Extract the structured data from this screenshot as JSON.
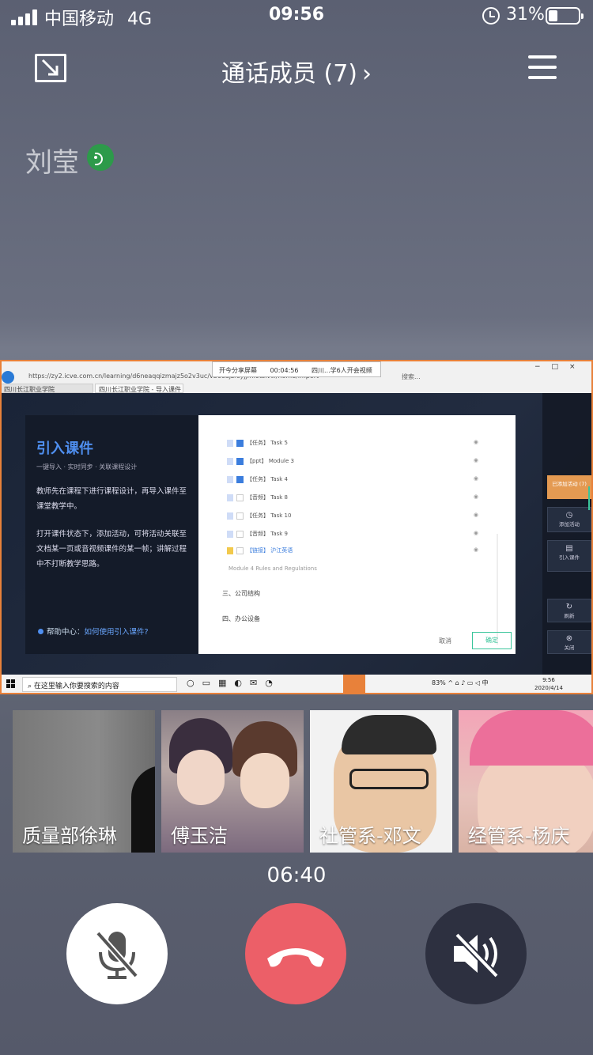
{
  "status": {
    "carrier": "中国移动",
    "network": "4G",
    "time": "09:56",
    "battery": "31%",
    "battery_level": 0.31
  },
  "header": {
    "title": "通话成员 (7)",
    "chevron": "›"
  },
  "speaker": {
    "name": "刘莹"
  },
  "share": {
    "url": "https://zy2.icve.com.cn/learning/d6neaqqizmajz5o2v3uc/vb6eajzrsyjjmi0tsivw/home/import",
    "banner_label": "开今分享屏幕",
    "banner_time": "00:04:56",
    "banner_room": "四川...学6人开会视频",
    "search_placeholder": "搜索...",
    "tabs": [
      "四川长江职业学院",
      "四川长江职业学院 - 导入课件"
    ],
    "slide": {
      "title": "引入课件",
      "subtitle": "一键导入 · 实时同步 · 关联课程设计",
      "para1": "教师先在课程下进行课程设计，再导入课件至课堂教学中。",
      "para2": "打开课件状态下，添加活动，可将活动关联至文档某一页或音视频课件的某一帧；讲解过程中不打断教学思路。",
      "help_label": "帮助中心：",
      "help_link": "如何使用引入课件?"
    },
    "dialog": {
      "items": [
        {
          "label": "【任务】 Task 5",
          "checked": true
        },
        {
          "label": "【ppt】 Module 3",
          "checked": true
        },
        {
          "label": "【任务】 Task 4",
          "checked": true
        },
        {
          "label": "【音频】 Task 8",
          "checked": false
        },
        {
          "label": "【任务】 Task 10",
          "checked": false
        },
        {
          "label": "【音频】 Task 9",
          "checked": false
        },
        {
          "label": "【链接】 沪江英语",
          "checked": false
        }
      ],
      "module_line": "Module 4 Rules and Regulations",
      "section3": "三、公司结构",
      "section4": "四、办公设备",
      "cancel": "取消",
      "ok": "确定"
    },
    "tools": [
      {
        "label": "已添加活动 (7)"
      },
      {
        "label": "添加活动"
      },
      {
        "label": "引入课件"
      },
      {
        "label": "刷新"
      },
      {
        "label": "关闭"
      }
    ],
    "taskbar": {
      "search": "在这里输入你要搜索的内容",
      "tray": "83% ^ ⌂ ♪ ▭ ◁ 中",
      "time": "9:56",
      "date": "2020/4/14"
    }
  },
  "participants": [
    {
      "name": "质量部徐琳"
    },
    {
      "name": "傅玉洁"
    },
    {
      "name": "社管系-邓文"
    },
    {
      "name": "经管系-杨庆"
    }
  ],
  "call": {
    "duration": "06:40"
  },
  "icons": {
    "minimize": "minimize-icon",
    "menu": "menu-icon",
    "mute": "mic-off-icon",
    "hangup": "phone-hangup-icon",
    "speaker": "speaker-off-icon"
  },
  "colors": {
    "hangup": "#ec5f68",
    "voice_active": "#2d9a4a",
    "share_border": "#e8813a",
    "accent_blue": "#4f8ff0"
  }
}
